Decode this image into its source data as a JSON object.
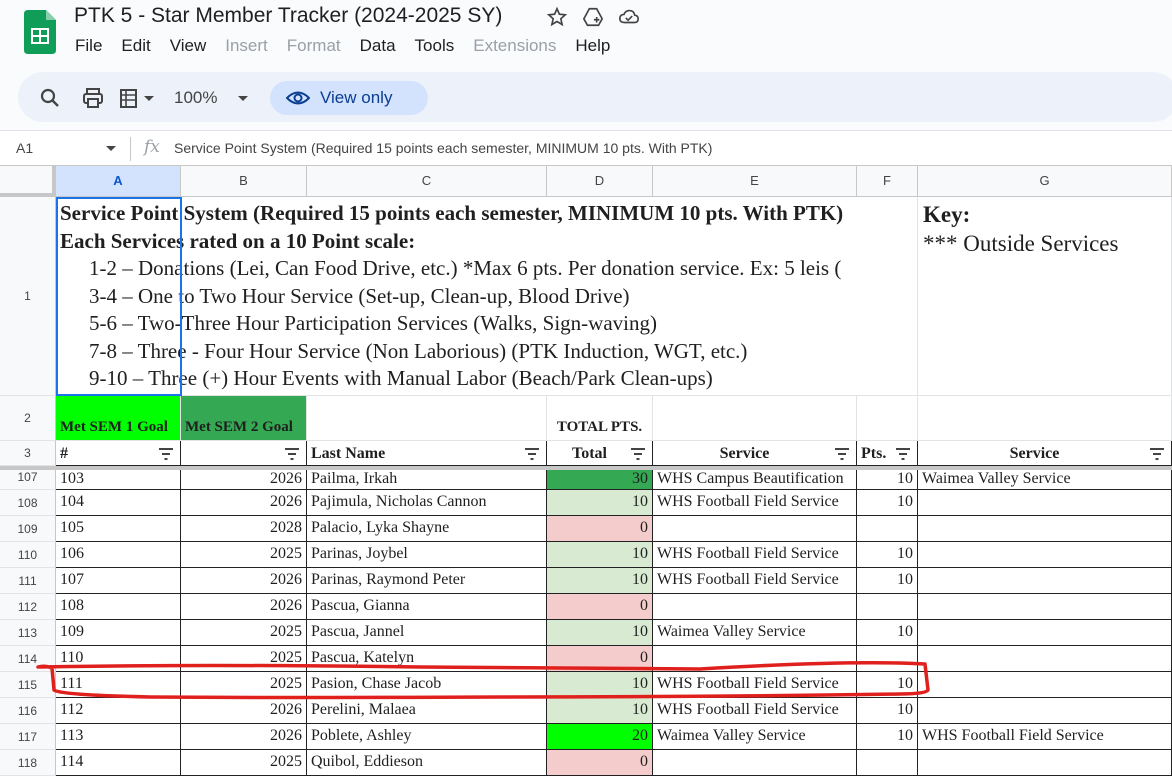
{
  "app": {
    "doc_title": "PTK 5 - Star Member Tracker (2024-2025 SY)",
    "menu": [
      {
        "label": "File",
        "enabled": true
      },
      {
        "label": "Edit",
        "enabled": true
      },
      {
        "label": "View",
        "enabled": true
      },
      {
        "label": "Insert",
        "enabled": false
      },
      {
        "label": "Format",
        "enabled": false
      },
      {
        "label": "Data",
        "enabled": true
      },
      {
        "label": "Tools",
        "enabled": true
      },
      {
        "label": "Extensions",
        "enabled": false
      },
      {
        "label": "Help",
        "enabled": true
      }
    ]
  },
  "toolbar": {
    "zoom": "100%",
    "view_only_label": "View only",
    "icons": [
      "search-icon",
      "print-icon",
      "format-options-icon",
      "chevron-down-icon"
    ]
  },
  "formula_bar": {
    "cell_ref": "A1",
    "fx_label": "fx",
    "content": "Service Point System (Required 15 points each semester, MINIMUM 10 pts. With PTK)"
  },
  "columns": [
    "A",
    "B",
    "C",
    "D",
    "E",
    "F",
    "G"
  ],
  "row1": {
    "line1": "Service Point System (Required 15 points each semester, MINIMUM 10 pts. With PTK)",
    "line2": "Each Services rated on a 10 Point scale:",
    "items": [
      "1-2 – Donations (Lei, Can Food Drive, etc.) *Max 6 pts. Per donation service. Ex: 5 leis (",
      "3-4 – One to Two Hour Service (Set-up, Clean-up, Blood Drive)",
      "5-6 – Two-Three Hour Participation Services (Walks, Sign-waving)",
      "7-8 – Three - Four Hour Service (Non Laborious) (PTK Induction, WGT, etc.)",
      "9-10 – Three (+) Hour Events with Manual Labor (Beach/Park Clean-ups)"
    ],
    "key_title": "Key:",
    "key_line": "*** Outside Services"
  },
  "row2": {
    "a": "Met SEM 1 Goal",
    "b": "Met SEM 2 Goal",
    "d": "TOTAL PTS."
  },
  "header_row": {
    "a": "#",
    "b": "",
    "c": "Last Name",
    "d": "Total",
    "e": "Service",
    "f": "Pts.",
    "g": "Service"
  },
  "colors": {
    "green_header": "#00ff00",
    "dark_green_header": "#34a853",
    "light_green": "#d9ead3",
    "light_red": "#f4cccc",
    "mid_green": "#34a853",
    "bright_green": "#00ff00",
    "annotation_red": "#e0201d"
  },
  "rows": [
    {
      "row": "107",
      "num": "103",
      "year": "2026",
      "name": "Pailma, Irkah",
      "total": "30",
      "service": "WHS Campus Beautification",
      "pts": "10",
      "service2": "Waimea Valley Service",
      "fill": "mid"
    },
    {
      "row": "108",
      "num": "104",
      "year": "2026",
      "name": "Pajimula, Nicholas Cannon",
      "total": "10",
      "service": "WHS Football Field Service",
      "pts": "10",
      "service2": "",
      "fill": "light"
    },
    {
      "row": "109",
      "num": "105",
      "year": "2028",
      "name": "Palacio, Lyka Shayne",
      "total": "0",
      "service": "",
      "pts": "",
      "service2": "",
      "fill": "red"
    },
    {
      "row": "110",
      "num": "106",
      "year": "2025",
      "name": "Parinas, Joybel",
      "total": "10",
      "service": "WHS Football Field Service",
      "pts": "10",
      "service2": "",
      "fill": "light"
    },
    {
      "row": "111",
      "num": "107",
      "year": "2026",
      "name": "Parinas, Raymond Peter",
      "total": "10",
      "service": "WHS Football Field Service",
      "pts": "10",
      "service2": "",
      "fill": "light"
    },
    {
      "row": "112",
      "num": "108",
      "year": "2026",
      "name": "Pascua, Gianna",
      "total": "0",
      "service": "",
      "pts": "",
      "service2": "",
      "fill": "red"
    },
    {
      "row": "113",
      "num": "109",
      "year": "2025",
      "name": "Pascua, Jannel",
      "total": "10",
      "service": "Waimea Valley Service",
      "pts": "10",
      "service2": "",
      "fill": "light"
    },
    {
      "row": "114",
      "num": "110",
      "year": "2025",
      "name": "Pascua, Katelyn",
      "total": "0",
      "service": "",
      "pts": "",
      "service2": "",
      "fill": "red"
    },
    {
      "row": "115",
      "num": "111",
      "year": "2025",
      "name": "Pasion, Chase Jacob",
      "total": "10",
      "service": "WHS Football Field Service",
      "pts": "10",
      "service2": "",
      "fill": "light"
    },
    {
      "row": "116",
      "num": "112",
      "year": "2026",
      "name": "Perelini, Malaea",
      "total": "10",
      "service": "WHS Football Field Service",
      "pts": "10",
      "service2": "",
      "fill": "light"
    },
    {
      "row": "117",
      "num": "113",
      "year": "2026",
      "name": "Poblete, Ashley",
      "total": "20",
      "service": "Waimea Valley Service",
      "pts": "10",
      "service2": "WHS Football Field Service",
      "fill": "bright"
    },
    {
      "row": "118",
      "num": "114",
      "year": "2025",
      "name": "Quibol, Eddieson",
      "total": "0",
      "service": "",
      "pts": "",
      "service2": "",
      "fill": "red"
    }
  ]
}
